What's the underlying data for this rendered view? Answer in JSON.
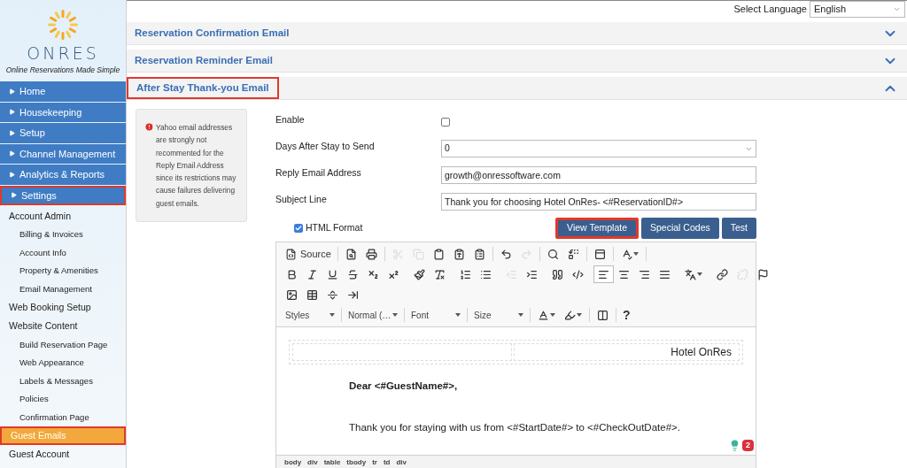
{
  "language": {
    "label": "Select Language",
    "value": "English"
  },
  "sidebar": {
    "logo": {
      "name": "ONRES",
      "tagline": "Online Reservations Made Simple"
    },
    "nav": [
      {
        "label": "Home",
        "highlighted": false
      },
      {
        "label": "Housekeeping",
        "highlighted": false
      },
      {
        "label": "Setup",
        "highlighted": false
      },
      {
        "label": "Channel Management",
        "highlighted": false
      },
      {
        "label": "Analytics & Reports",
        "highlighted": false
      },
      {
        "label": "Settings",
        "highlighted": true
      }
    ],
    "links": [
      {
        "label": "Account Admin",
        "selected": false,
        "highlighted": false,
        "children": [
          {
            "label": "Billing & Invoices",
            "selected": false
          },
          {
            "label": "Account Info",
            "selected": false
          },
          {
            "label": "Property & Amenities",
            "selected": false
          },
          {
            "label": "Email Management",
            "selected": false
          }
        ]
      },
      {
        "label": "Web Booking Setup",
        "selected": false,
        "highlighted": false
      },
      {
        "label": "Website Content",
        "selected": false,
        "highlighted": false,
        "children": [
          {
            "label": "Build Reservation Page",
            "selected": false
          },
          {
            "label": "Web Appearance",
            "selected": false
          },
          {
            "label": "Labels & Messages",
            "selected": false
          },
          {
            "label": "Policies",
            "selected": false
          },
          {
            "label": "Confirmation Page",
            "selected": false
          }
        ]
      },
      {
        "label": "Guest Emails",
        "selected": true,
        "highlighted": true
      },
      {
        "label": "Guest Account",
        "selected": false,
        "highlighted": false
      }
    ]
  },
  "sections": [
    {
      "title": "Reservation Confirmation Email",
      "expanded": false,
      "highlighted": false
    },
    {
      "title": "Reservation Reminder Email",
      "expanded": false,
      "highlighted": false
    },
    {
      "title": "After Stay Thank-you Email",
      "expanded": true,
      "highlighted": true
    }
  ],
  "notice": {
    "text": "Yahoo email addresses are strongly not recommented for the Reply Email Address since its restrictions may cause failures delivering guest emails."
  },
  "form": [
    {
      "kind": "checkbox",
      "label": "Enable",
      "checked": false
    },
    {
      "kind": "select",
      "label": "Days After Stay to Send",
      "value": "0"
    },
    {
      "kind": "text",
      "label": "Reply Email Address",
      "value": "growth@onressoftware.com"
    },
    {
      "kind": "text",
      "label": "Subject Line",
      "value": "Thank you for choosing Hotel OnRes- <#ReservationID#>"
    }
  ],
  "html_format": {
    "label": "HTML Format",
    "checked": true
  },
  "buttons": [
    {
      "label": "View Template",
      "highlighted": true
    },
    {
      "label": "Special Codes",
      "highlighted": false
    },
    {
      "label": "Test",
      "highlighted": false
    }
  ],
  "editor": {
    "toolbar": [
      [
        {
          "kind": "labeled",
          "label": "Source",
          "disabled": false,
          "selected": false
        },
        {
          "kind": "separator"
        },
        {
          "kind": "icon",
          "disabled": false,
          "selected": false
        },
        {
          "kind": "icon",
          "disabled": false,
          "selected": false
        },
        {
          "kind": "separator"
        },
        {
          "kind": "icon",
          "disabled": true,
          "selected": false
        },
        {
          "kind": "icon",
          "disabled": true,
          "selected": false
        },
        {
          "kind": "icon",
          "disabled": false,
          "selected": false
        },
        {
          "kind": "icon",
          "disabled": false,
          "selected": false
        },
        {
          "kind": "icon",
          "disabled": false,
          "selected": false
        },
        {
          "kind": "separator"
        },
        {
          "kind": "icon",
          "disabled": false,
          "selected": false
        },
        {
          "kind": "icon",
          "disabled": true,
          "selected": false
        },
        {
          "kind": "separator"
        },
        {
          "kind": "icon",
          "disabled": false,
          "selected": false
        },
        {
          "kind": "icon",
          "disabled": false,
          "selected": false
        },
        {
          "kind": "separator"
        },
        {
          "kind": "icon",
          "disabled": false,
          "selected": false
        },
        {
          "kind": "separator"
        },
        {
          "kind": "icon",
          "disabled": false,
          "selected": false
        },
        {
          "kind": "separator"
        }
      ],
      [
        {
          "kind": "icon",
          "disabled": false,
          "selected": false
        },
        {
          "kind": "icon",
          "disabled": false,
          "selected": false
        },
        {
          "kind": "icon",
          "disabled": false,
          "selected": false
        },
        {
          "kind": "icon",
          "disabled": false,
          "selected": false
        },
        {
          "kind": "icon",
          "disabled": false,
          "selected": false
        },
        {
          "kind": "icon",
          "disabled": false,
          "selected": false
        },
        {
          "kind": "separator"
        },
        {
          "kind": "icon",
          "disabled": false,
          "selected": false
        },
        {
          "kind": "icon",
          "disabled": false,
          "selected": false
        },
        {
          "kind": "separator"
        },
        {
          "kind": "icon",
          "disabled": false,
          "selected": false
        },
        {
          "kind": "icon",
          "disabled": false,
          "selected": false
        },
        {
          "kind": "separator"
        },
        {
          "kind": "icon",
          "disabled": true,
          "selected": false
        },
        {
          "kind": "icon",
          "disabled": false,
          "selected": false
        },
        {
          "kind": "separator"
        },
        {
          "kind": "icon",
          "disabled": false,
          "selected": false
        },
        {
          "kind": "icon",
          "disabled": false,
          "selected": false
        },
        {
          "kind": "separator"
        },
        {
          "kind": "icon",
          "disabled": false,
          "selected": true
        },
        {
          "kind": "icon",
          "disabled": false,
          "selected": false
        },
        {
          "kind": "icon",
          "disabled": false,
          "selected": false
        },
        {
          "kind": "icon",
          "disabled": false,
          "selected": false
        },
        {
          "kind": "separator"
        },
        {
          "kind": "icon",
          "disabled": false,
          "selected": false
        },
        {
          "kind": "separator"
        },
        {
          "kind": "icon",
          "disabled": false,
          "selected": false
        },
        {
          "kind": "icon",
          "disabled": true,
          "selected": false
        },
        {
          "kind": "icon",
          "disabled": false,
          "selected": false
        },
        {
          "kind": "separator"
        }
      ],
      [
        {
          "kind": "icon",
          "disabled": false,
          "selected": false
        },
        {
          "kind": "icon",
          "disabled": false,
          "selected": false
        },
        {
          "kind": "icon",
          "disabled": false,
          "selected": false
        },
        {
          "kind": "icon",
          "disabled": false,
          "selected": false
        }
      ],
      [
        {
          "kind": "dropdown",
          "label": "Styles"
        },
        {
          "kind": "separator"
        },
        {
          "kind": "dropdown",
          "label": "Normal (…"
        },
        {
          "kind": "separator"
        },
        {
          "kind": "dropdown",
          "label": "Font"
        },
        {
          "kind": "separator"
        },
        {
          "kind": "dropdown",
          "label": "Size"
        },
        {
          "kind": "separator"
        },
        {
          "kind": "icon",
          "disabled": false,
          "selected": false
        },
        {
          "kind": "icon",
          "disabled": false,
          "selected": false
        },
        {
          "kind": "separator"
        },
        {
          "kind": "icon",
          "disabled": false,
          "selected": false
        },
        {
          "kind": "separator"
        },
        {
          "kind": "glyph",
          "label": "?"
        }
      ]
    ],
    "header_text": "Hotel OnRes",
    "greeting": "Dear <#GuestName#>,",
    "body": "Thank you for staying with us from <#StartDate#> to <#CheckOutDate#>.",
    "path": [
      "body",
      "div",
      "table",
      "tbody",
      "tr",
      "td",
      "div"
    ],
    "widget_count": "2"
  }
}
